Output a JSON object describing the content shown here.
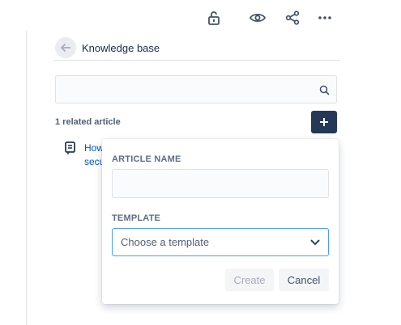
{
  "toolbar": {
    "icons": [
      "unlock-icon",
      "eye-icon",
      "share-icon",
      "more-icon"
    ]
  },
  "header": {
    "title": "Knowledge base",
    "back_icon": "arrow-left-icon"
  },
  "search": {
    "value": "",
    "placeholder": "",
    "icon": "search-icon"
  },
  "related": {
    "label": "1 related article",
    "add_icon": "plus-icon",
    "articles": [
      {
        "line1": "How",
        "line2": "secu",
        "icon": "article-icon"
      }
    ]
  },
  "popup": {
    "article_name_label": "ARTICLE NAME",
    "article_name_value": "",
    "template_label": "TEMPLATE",
    "template_placeholder": "Choose a template",
    "create_label": "Create",
    "cancel_label": "Cancel"
  },
  "colors": {
    "primary_dark": "#253858",
    "link": "#0052cc",
    "focus": "#4c9aff",
    "muted_text": "#5e6c84"
  }
}
